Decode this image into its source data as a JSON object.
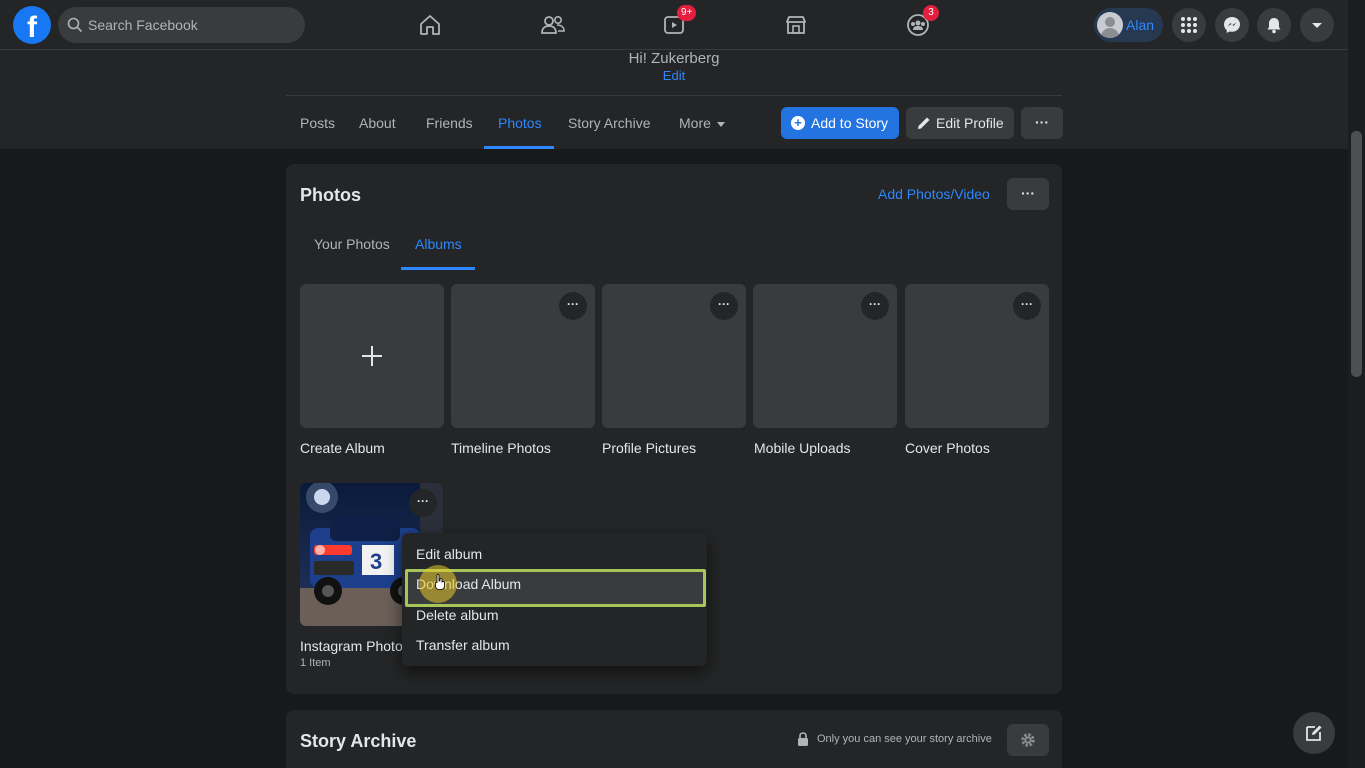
{
  "topbar": {
    "logo_letter": "f",
    "search_placeholder": "Search Facebook",
    "watch_badge": "9+",
    "groups_badge": "3",
    "user_name": "Alan"
  },
  "profile": {
    "greeting": "Hi! Zukerberg",
    "edit_link": "Edit",
    "tabs": [
      "Posts",
      "About",
      "Friends",
      "Photos",
      "Story Archive",
      "More"
    ],
    "active_tab": "Photos",
    "add_to_story": "Add to Story",
    "edit_profile": "Edit Profile",
    "more_dots": "···"
  },
  "photos_card": {
    "title": "Photos",
    "add_photos_video": "Add Photos/Video",
    "subtabs": [
      "Your Photos",
      "Albums"
    ],
    "active_subtab": "Albums",
    "albums": [
      {
        "name": "Create Album"
      },
      {
        "name": "Timeline Photos"
      },
      {
        "name": "Profile Pictures"
      },
      {
        "name": "Mobile Uploads"
      },
      {
        "name": "Cover Photos"
      },
      {
        "name": "Instagram Photo",
        "count": "1 Item"
      }
    ]
  },
  "context_menu": {
    "items": [
      "Edit album",
      "Download Album",
      "Delete album",
      "Transfer album"
    ],
    "highlighted": "Download Album"
  },
  "story_archive": {
    "title": "Story Archive",
    "privacy_note": "Only you can see your story archive"
  },
  "colors": {
    "accent": "#2d88ff",
    "background": "#18191a",
    "card": "#242526",
    "highlight_border": "#a8c55a"
  }
}
